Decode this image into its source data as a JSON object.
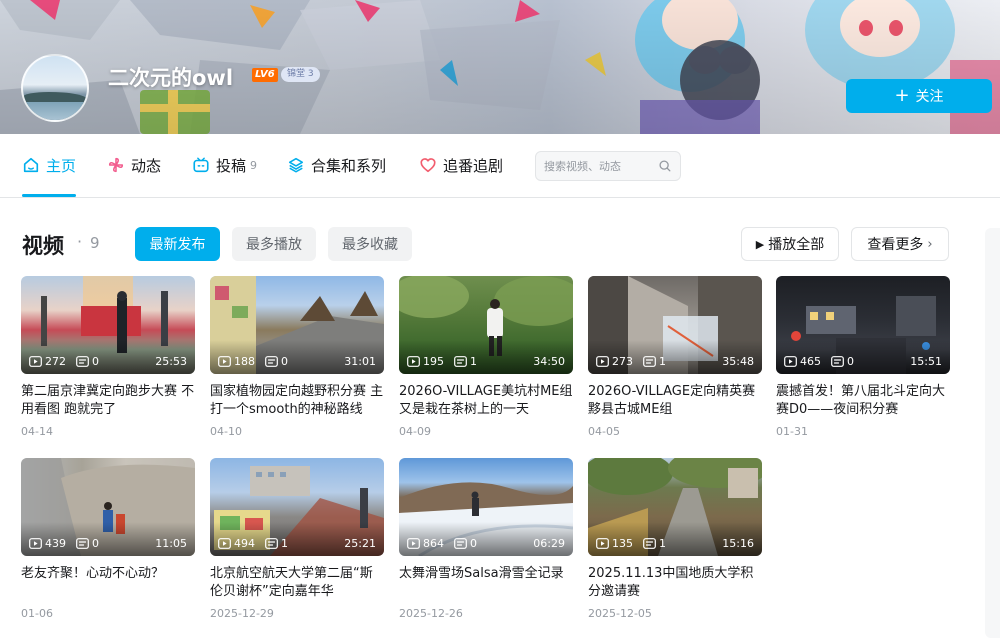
{
  "user": {
    "name": "二次元的owl",
    "level": "LV6",
    "medal": "锦堂 3"
  },
  "follow_button": {
    "icon": "plus-icon",
    "label": "关注"
  },
  "nav": {
    "items": [
      {
        "label": "主页",
        "icon": "home-icon",
        "count": ""
      },
      {
        "label": "动态",
        "icon": "pinwheel-icon",
        "count": ""
      },
      {
        "label": "投稿",
        "icon": "tv-icon",
        "count": "9"
      },
      {
        "label": "合集和系列",
        "icon": "layers-icon",
        "count": ""
      },
      {
        "label": "追番追剧",
        "icon": "heart-icon",
        "count": ""
      }
    ],
    "search_placeholder": "搜索视频、动态"
  },
  "section": {
    "title": "视频",
    "dot": "·",
    "count": "9",
    "sort": [
      "最新发布",
      "最多播放",
      "最多收藏"
    ],
    "play_all": "播放全部",
    "see_more": "查看更多"
  },
  "videos": [
    {
      "views": "272",
      "comments": "0",
      "duration": "25:53",
      "title": "第二届京津冀定向跑步大赛 不用看图 跑就完了",
      "date": "04-14"
    },
    {
      "views": "188",
      "comments": "0",
      "duration": "31:01",
      "title": "国家植物园定向越野积分赛 主打一个smooth的神秘路线",
      "date": "04-10"
    },
    {
      "views": "195",
      "comments": "1",
      "duration": "34:50",
      "title": "2026O-VILLAGE美坑村ME组 又是栽在茶树上的一天",
      "date": "04-09"
    },
    {
      "views": "273",
      "comments": "1",
      "duration": "35:48",
      "title": "2026O-VILLAGE定向精英赛 黟县古城ME组",
      "date": "04-05"
    },
    {
      "views": "465",
      "comments": "0",
      "duration": "15:51",
      "title": "震撼首发！第八届北斗定向大赛D0——夜间积分赛",
      "date": "01-31"
    },
    {
      "views": "439",
      "comments": "0",
      "duration": "11:05",
      "title": "老友齐聚！心动不心动？",
      "date": "01-06"
    },
    {
      "views": "494",
      "comments": "1",
      "duration": "25:21",
      "title": "北京航空航天大学第二届“斯伦贝谢杯”定向嘉年华",
      "date": "2025-12-29"
    },
    {
      "views": "864",
      "comments": "0",
      "duration": "06:29",
      "title": "太舞滑雪场Salsa滑雪全记录",
      "date": "2025-12-26"
    },
    {
      "views": "135",
      "comments": "1",
      "duration": "15:16",
      "title": "2025.11.13中国地质大学积分邀请赛",
      "date": "2025-12-05"
    }
  ]
}
